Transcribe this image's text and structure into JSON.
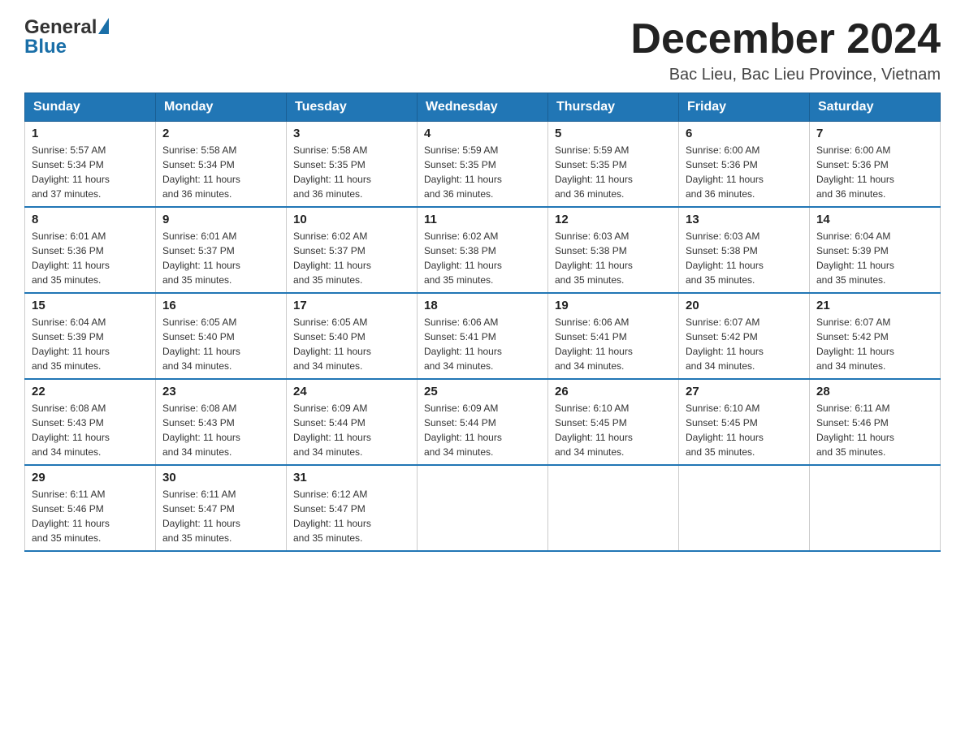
{
  "header": {
    "logo_general": "General",
    "logo_blue": "Blue",
    "title": "December 2024",
    "subtitle": "Bac Lieu, Bac Lieu Province, Vietnam"
  },
  "calendar": {
    "days_of_week": [
      "Sunday",
      "Monday",
      "Tuesday",
      "Wednesday",
      "Thursday",
      "Friday",
      "Saturday"
    ],
    "weeks": [
      [
        {
          "day": "1",
          "sunrise": "Sunrise: 5:57 AM",
          "sunset": "Sunset: 5:34 PM",
          "daylight": "Daylight: 11 hours and 37 minutes."
        },
        {
          "day": "2",
          "sunrise": "Sunrise: 5:58 AM",
          "sunset": "Sunset: 5:34 PM",
          "daylight": "Daylight: 11 hours and 36 minutes."
        },
        {
          "day": "3",
          "sunrise": "Sunrise: 5:58 AM",
          "sunset": "Sunset: 5:35 PM",
          "daylight": "Daylight: 11 hours and 36 minutes."
        },
        {
          "day": "4",
          "sunrise": "Sunrise: 5:59 AM",
          "sunset": "Sunset: 5:35 PM",
          "daylight": "Daylight: 11 hours and 36 minutes."
        },
        {
          "day": "5",
          "sunrise": "Sunrise: 5:59 AM",
          "sunset": "Sunset: 5:35 PM",
          "daylight": "Daylight: 11 hours and 36 minutes."
        },
        {
          "day": "6",
          "sunrise": "Sunrise: 6:00 AM",
          "sunset": "Sunset: 5:36 PM",
          "daylight": "Daylight: 11 hours and 36 minutes."
        },
        {
          "day": "7",
          "sunrise": "Sunrise: 6:00 AM",
          "sunset": "Sunset: 5:36 PM",
          "daylight": "Daylight: 11 hours and 36 minutes."
        }
      ],
      [
        {
          "day": "8",
          "sunrise": "Sunrise: 6:01 AM",
          "sunset": "Sunset: 5:36 PM",
          "daylight": "Daylight: 11 hours and 35 minutes."
        },
        {
          "day": "9",
          "sunrise": "Sunrise: 6:01 AM",
          "sunset": "Sunset: 5:37 PM",
          "daylight": "Daylight: 11 hours and 35 minutes."
        },
        {
          "day": "10",
          "sunrise": "Sunrise: 6:02 AM",
          "sunset": "Sunset: 5:37 PM",
          "daylight": "Daylight: 11 hours and 35 minutes."
        },
        {
          "day": "11",
          "sunrise": "Sunrise: 6:02 AM",
          "sunset": "Sunset: 5:38 PM",
          "daylight": "Daylight: 11 hours and 35 minutes."
        },
        {
          "day": "12",
          "sunrise": "Sunrise: 6:03 AM",
          "sunset": "Sunset: 5:38 PM",
          "daylight": "Daylight: 11 hours and 35 minutes."
        },
        {
          "day": "13",
          "sunrise": "Sunrise: 6:03 AM",
          "sunset": "Sunset: 5:38 PM",
          "daylight": "Daylight: 11 hours and 35 minutes."
        },
        {
          "day": "14",
          "sunrise": "Sunrise: 6:04 AM",
          "sunset": "Sunset: 5:39 PM",
          "daylight": "Daylight: 11 hours and 35 minutes."
        }
      ],
      [
        {
          "day": "15",
          "sunrise": "Sunrise: 6:04 AM",
          "sunset": "Sunset: 5:39 PM",
          "daylight": "Daylight: 11 hours and 35 minutes."
        },
        {
          "day": "16",
          "sunrise": "Sunrise: 6:05 AM",
          "sunset": "Sunset: 5:40 PM",
          "daylight": "Daylight: 11 hours and 34 minutes."
        },
        {
          "day": "17",
          "sunrise": "Sunrise: 6:05 AM",
          "sunset": "Sunset: 5:40 PM",
          "daylight": "Daylight: 11 hours and 34 minutes."
        },
        {
          "day": "18",
          "sunrise": "Sunrise: 6:06 AM",
          "sunset": "Sunset: 5:41 PM",
          "daylight": "Daylight: 11 hours and 34 minutes."
        },
        {
          "day": "19",
          "sunrise": "Sunrise: 6:06 AM",
          "sunset": "Sunset: 5:41 PM",
          "daylight": "Daylight: 11 hours and 34 minutes."
        },
        {
          "day": "20",
          "sunrise": "Sunrise: 6:07 AM",
          "sunset": "Sunset: 5:42 PM",
          "daylight": "Daylight: 11 hours and 34 minutes."
        },
        {
          "day": "21",
          "sunrise": "Sunrise: 6:07 AM",
          "sunset": "Sunset: 5:42 PM",
          "daylight": "Daylight: 11 hours and 34 minutes."
        }
      ],
      [
        {
          "day": "22",
          "sunrise": "Sunrise: 6:08 AM",
          "sunset": "Sunset: 5:43 PM",
          "daylight": "Daylight: 11 hours and 34 minutes."
        },
        {
          "day": "23",
          "sunrise": "Sunrise: 6:08 AM",
          "sunset": "Sunset: 5:43 PM",
          "daylight": "Daylight: 11 hours and 34 minutes."
        },
        {
          "day": "24",
          "sunrise": "Sunrise: 6:09 AM",
          "sunset": "Sunset: 5:44 PM",
          "daylight": "Daylight: 11 hours and 34 minutes."
        },
        {
          "day": "25",
          "sunrise": "Sunrise: 6:09 AM",
          "sunset": "Sunset: 5:44 PM",
          "daylight": "Daylight: 11 hours and 34 minutes."
        },
        {
          "day": "26",
          "sunrise": "Sunrise: 6:10 AM",
          "sunset": "Sunset: 5:45 PM",
          "daylight": "Daylight: 11 hours and 34 minutes."
        },
        {
          "day": "27",
          "sunrise": "Sunrise: 6:10 AM",
          "sunset": "Sunset: 5:45 PM",
          "daylight": "Daylight: 11 hours and 35 minutes."
        },
        {
          "day": "28",
          "sunrise": "Sunrise: 6:11 AM",
          "sunset": "Sunset: 5:46 PM",
          "daylight": "Daylight: 11 hours and 35 minutes."
        }
      ],
      [
        {
          "day": "29",
          "sunrise": "Sunrise: 6:11 AM",
          "sunset": "Sunset: 5:46 PM",
          "daylight": "Daylight: 11 hours and 35 minutes."
        },
        {
          "day": "30",
          "sunrise": "Sunrise: 6:11 AM",
          "sunset": "Sunset: 5:47 PM",
          "daylight": "Daylight: 11 hours and 35 minutes."
        },
        {
          "day": "31",
          "sunrise": "Sunrise: 6:12 AM",
          "sunset": "Sunset: 5:47 PM",
          "daylight": "Daylight: 11 hours and 35 minutes."
        },
        null,
        null,
        null,
        null
      ]
    ]
  }
}
